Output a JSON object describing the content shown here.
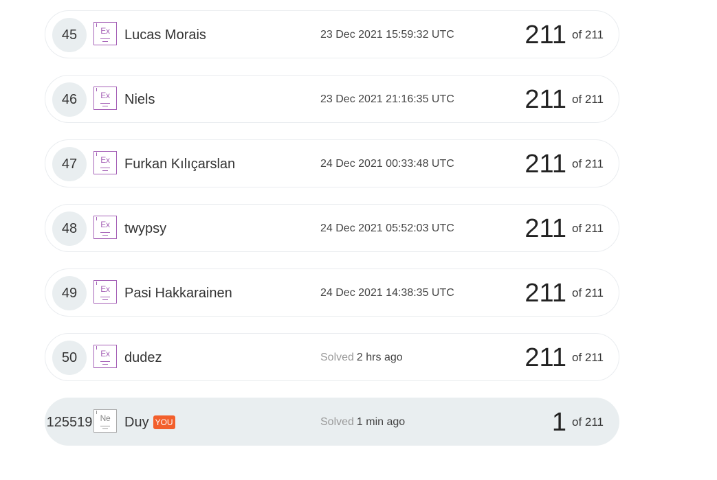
{
  "rows": [
    {
      "rank": "45",
      "level": "Ex",
      "name": "Lucas Morais",
      "time": "23 Dec 2021 15:59:32 UTC",
      "score": "211",
      "of": "of 211"
    },
    {
      "rank": "46",
      "level": "Ex",
      "name": "Niels",
      "time": "23 Dec 2021 21:16:35 UTC",
      "score": "211",
      "of": "of 211"
    },
    {
      "rank": "47",
      "level": "Ex",
      "name": "Furkan Kılıçarslan",
      "time": "24 Dec 2021 00:33:48 UTC",
      "score": "211",
      "of": "of 211"
    },
    {
      "rank": "48",
      "level": "Ex",
      "name": "twypsy",
      "time": "24 Dec 2021 05:52:03 UTC",
      "score": "211",
      "of": "of 211"
    },
    {
      "rank": "49",
      "level": "Ex",
      "name": "Pasi Hakkarainen",
      "time": "24 Dec 2021 14:38:35 UTC",
      "score": "211",
      "of": "of 211"
    },
    {
      "rank": "50",
      "level": "Ex",
      "name": "dudez",
      "solved_prefix": "Solved",
      "time": "2 hrs ago",
      "score": "211",
      "of": "of 211"
    },
    {
      "rank": "125519",
      "level": "Ne",
      "name": "Duy",
      "badge": "YOU",
      "solved_prefix": "Solved",
      "time": "1 min ago",
      "score": "1",
      "of": "of 211"
    }
  ],
  "colors": {
    "expert_level": "#a45fb6",
    "novice_level": "#999999",
    "you_badge": "#f25f2c",
    "you_row_bg": "#e9eef0"
  },
  "icons": {
    "level_icon": "level-badge-icon"
  }
}
